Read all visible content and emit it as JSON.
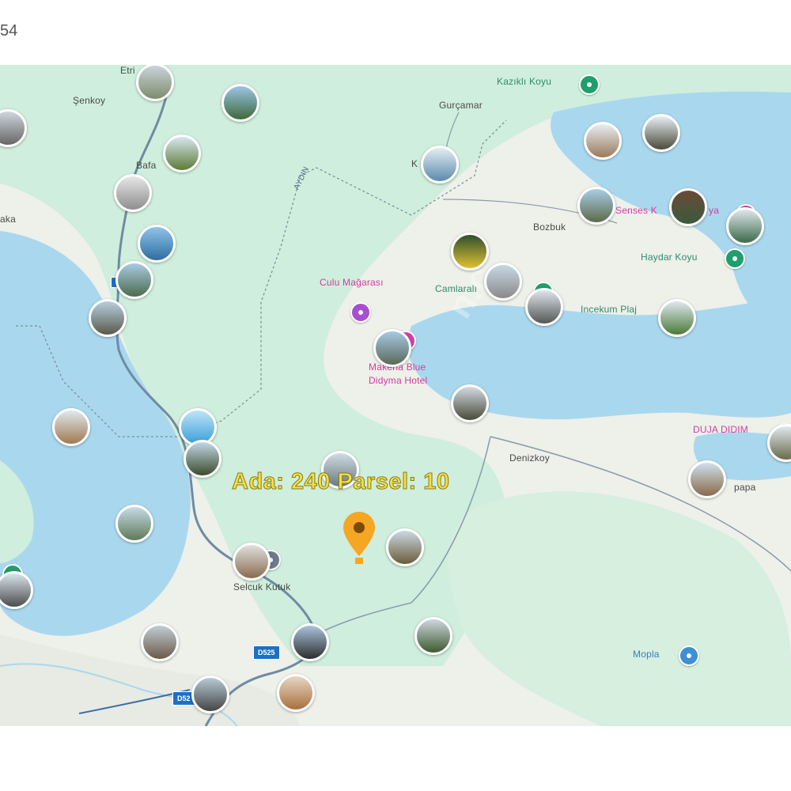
{
  "header_fragment": "54",
  "parcel": {
    "label": "Ada: 240  Parsel: 10"
  },
  "colors": {
    "sea": "#a9d8ee",
    "land_green": "#cfeedd",
    "land_light": "#eef0ea",
    "parcel_text": "#f2df4a",
    "marker": "#f5a623"
  },
  "labels": {
    "etrim": "Etri",
    "senkoy": "Şenkoy",
    "bafa": "Bafa",
    "saka": "aka",
    "kazikli": "Kazıklı Koyu",
    "gurcamar": "Gurçamar",
    "k": "K",
    "bozbuk": "Bozbuk",
    "senses": "Senses K",
    "senses_end": "ya",
    "haydar": "Haydar Koyu",
    "incekum": "Incekum Plaj",
    "cukur": "Culu Mağarası",
    "camlarali": "Camlaralı",
    "makeria_1": "Makeria Blue",
    "makeria_2": "Didyma Hotel",
    "denizkoy": "Denizkoy",
    "duja": "DUJA DIDIM",
    "papa": "papa",
    "selcuk": "Selcuk Kutuk",
    "mopla": "Mopla",
    "road_aydin": "AYDIN"
  },
  "shields": {
    "d525_a": "D525",
    "d525_b": "D52"
  },
  "icons": [
    "map-pin-icon",
    "photo-thumbnail",
    "park-icon",
    "hotel-icon",
    "museum-icon"
  ]
}
